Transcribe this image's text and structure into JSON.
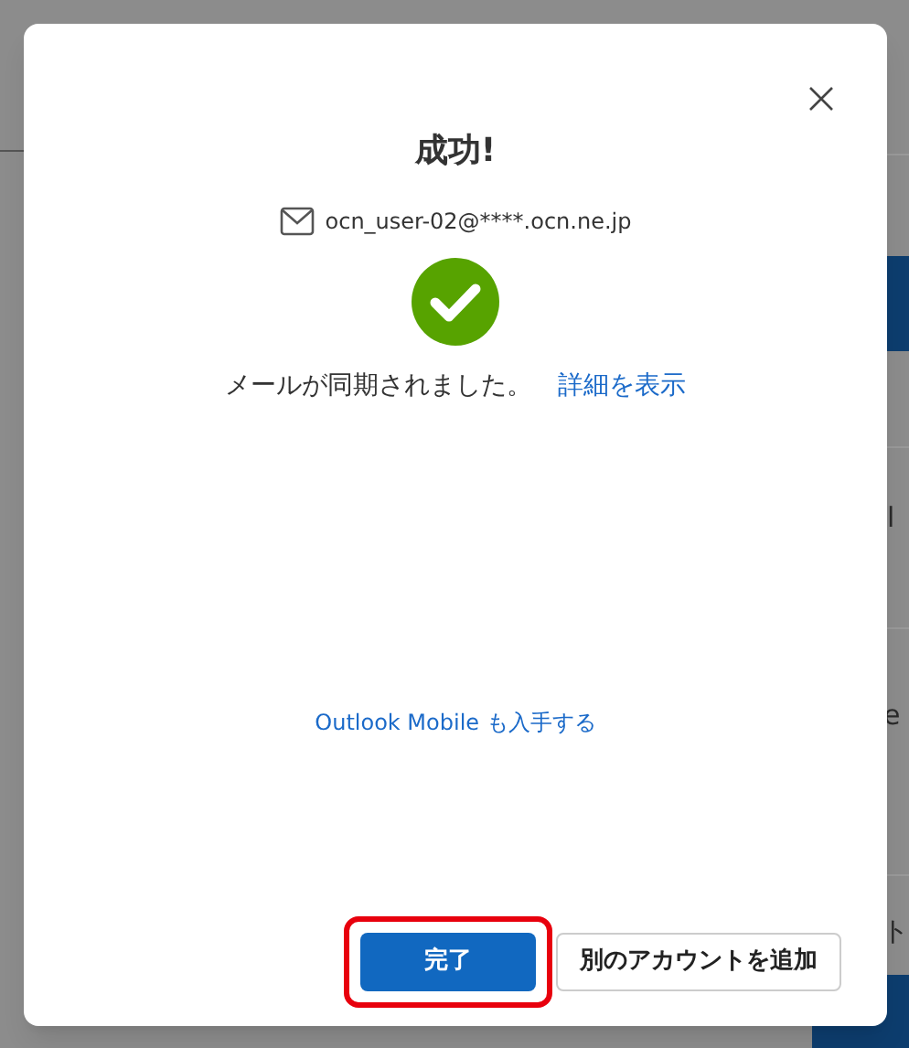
{
  "background": {
    "fragments": [
      {
        "text": "l",
        "kind": "text"
      },
      {
        "text": "e",
        "kind": "text"
      },
      {
        "text": "ト",
        "kind": "text"
      }
    ]
  },
  "dialog": {
    "title": "成功!",
    "email": "ocn_user-02@****.ocn.ne.jp",
    "message": "メールが同期されました。",
    "details_link": "詳細を表示",
    "mobile_link": "Outlook Mobile も入手する",
    "buttons": [
      {
        "label": "完了",
        "kind": "primary",
        "highlighted": true
      },
      {
        "label": "別のアカウントを追加",
        "kind": "secondary",
        "highlighted": false
      }
    ]
  }
}
